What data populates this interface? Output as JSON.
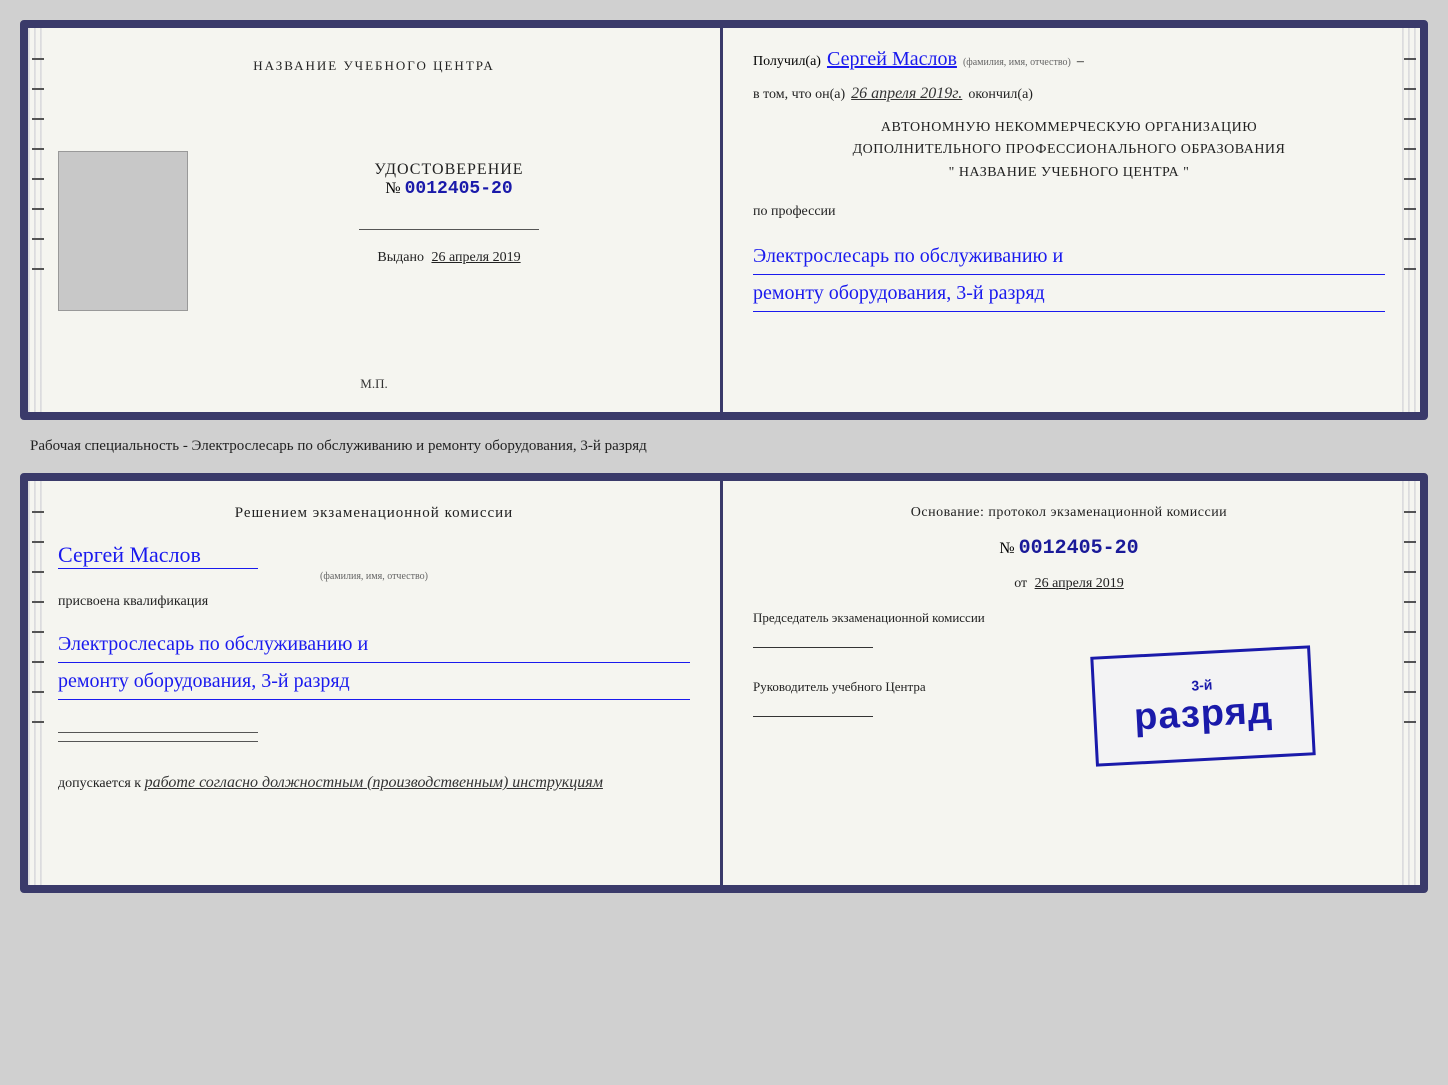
{
  "card1": {
    "left": {
      "school_name": "НАЗВАНИЕ УЧЕБНОГО ЦЕНТРА",
      "udostoverenie_title": "УДОСТОВЕРЕНИЕ",
      "number_prefix": "№",
      "number": "0012405-20",
      "vydano_label": "Выдано",
      "vydano_date": "26 апреля 2019",
      "mp_label": "М.П."
    },
    "right": {
      "poluchil_label": "Получил(а)",
      "recipient_name": "Сергей Маслов",
      "fio_small": "(фамилия, имя, отчество)",
      "dash": "–",
      "vtom_label": "в том, что он(а)",
      "completed_date": "26 апреля 2019г.",
      "okochnil_label": "окончил(а)",
      "org_line1": "АВТОНОМНУЮ НЕКОММЕРЧЕСКУЮ ОРГАНИЗАЦИЮ",
      "org_line2": "ДОПОЛНИТЕЛЬНОГО ПРОФЕССИОНАЛЬНОГО ОБРАЗОВАНИЯ",
      "org_line3": "\"  НАЗВАНИЕ УЧЕБНОГО ЦЕНТРА   \"",
      "po_professii": "по профессии",
      "profession_line1": "Электрослесарь по обслуживанию и",
      "profession_line2": "ремонту оборудования, 3-й разряд"
    }
  },
  "between_label": "Рабочая специальность - Электрослесарь по обслуживанию и ремонту оборудования, 3-й разряд",
  "card2": {
    "left": {
      "resheniem_title": "Решением экзаменационной комиссии",
      "recipient_name": "Сергей Маслов",
      "fio_small": "(фамилия, имя, отчество)",
      "prisvoena": "присвоена квалификация",
      "qualification_line1": "Электрослесарь по обслуживанию и",
      "qualification_line2": "ремонту оборудования, 3-й разряд",
      "dopuskaetsya_label": "допускается к",
      "dopuskaetsya_text": "работе согласно должностным (производственным) инструкциям"
    },
    "right": {
      "osnovanie": "Основание: протокол экзаменационной комиссии",
      "number_prefix": "№",
      "number": "0012405-20",
      "ot_prefix": "от",
      "ot_date": "26 апреля 2019",
      "predsedatel_label": "Председатель экзаменационной комиссии",
      "rukovoditel_label": "Руководитель учебного Центра"
    },
    "stamp": {
      "line1": "3-й",
      "line2": "разряд"
    }
  }
}
